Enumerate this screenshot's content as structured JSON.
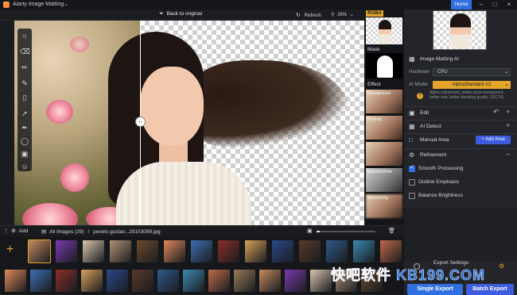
{
  "app": {
    "title": "Aiarty Image Matting",
    "home": "Home"
  },
  "toolbar": {
    "back_label": "Back to original",
    "refresh_label": "Refresh",
    "zoom": "26%"
  },
  "thumbcol": {
    "rgba": "RGBA",
    "mask": "Mask",
    "effect": "Effect",
    "captions": [
      "Background",
      "Portrait",
      "Black&White",
      "Blurred Bg"
    ]
  },
  "panel": {
    "matting_title": "Image Matting AI",
    "hardware_label": "Hardware",
    "hardware_value": "CPU",
    "model_label": "AI Model",
    "model_value": "AlphaStandard V2",
    "model_desc": "Alpha refinement, better semi-transparent, better hair, better blending quality. (GCTK)",
    "edit": "Edit",
    "ai_detect": "AI Detect",
    "manual_area": "Manual Area",
    "add_area": "+ Add Area",
    "refinement": "Refinement",
    "opt_smooth": "Smooth Processing",
    "opt_outline": "Outline Emphasis",
    "opt_balance": "Balance Brightness",
    "export_settings": "Export Settings",
    "single_export": "Single Export",
    "batch_export": "Batch Export"
  },
  "bottom": {
    "add": "Add",
    "all_images": "All Images (29)",
    "sep": "/",
    "filename": "pexels-gustav...29103099.jpg"
  },
  "watermark": "快吧软件 KB199.COM",
  "colors": {
    "accent": "#e2a52a",
    "primary": "#2f6fe0",
    "add_area": "#3d5ce0"
  }
}
